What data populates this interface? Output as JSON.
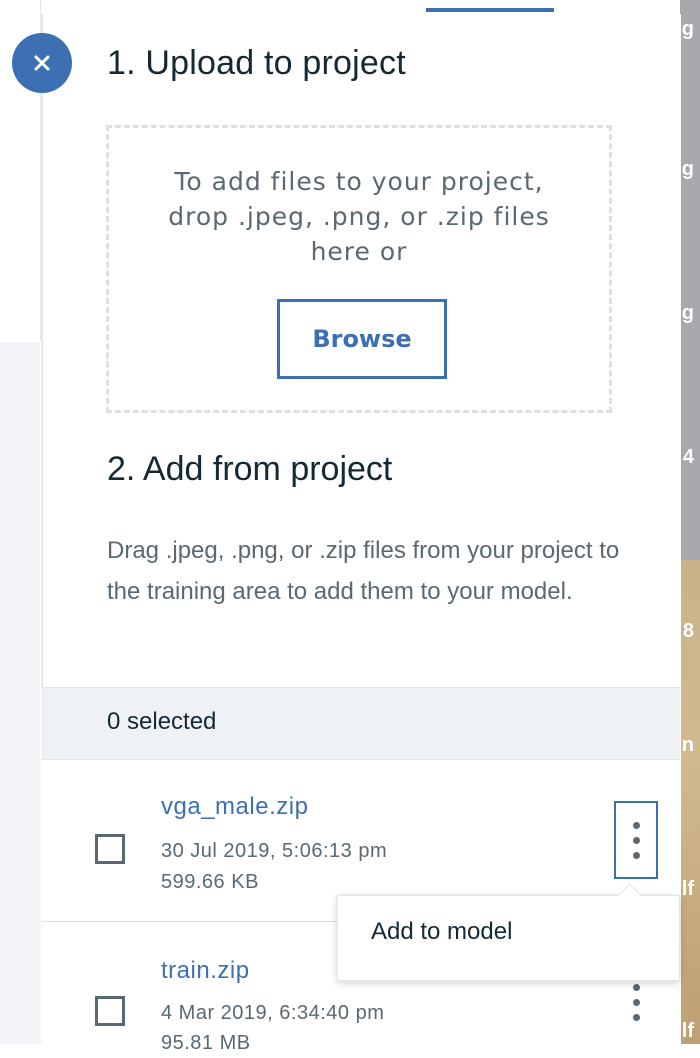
{
  "background": {
    "right_glyphs": [
      "g",
      "g",
      "g",
      "4",
      "8",
      "n",
      "lf",
      "lf"
    ]
  },
  "panel": {
    "close_icon": "close-icon",
    "upload_section": {
      "title": "1. Upload to project",
      "drop_lines": [
        "To add files to your project,",
        "drop .jpeg, .png, or .zip files",
        "here or"
      ],
      "browse_label": "Browse"
    },
    "add_section": {
      "title": "2. Add from project",
      "description": "Drag .jpeg, .png, or .zip files from your project to the training area to add them to your model."
    },
    "selection": {
      "label": "0 selected"
    },
    "files": [
      {
        "name": "vga_male.zip",
        "date": "30 Jul 2019, 5:06:13 pm",
        "size": "599.66 KB"
      },
      {
        "name": "train.zip",
        "date": "4 Mar 2019, 6:34:40 pm",
        "size": "95.81 MB"
      }
    ],
    "menu": {
      "add_to_model": "Add to model"
    }
  },
  "colors": {
    "accent": "#3d70b2",
    "text": "#152935",
    "muted": "#5a6872"
  }
}
